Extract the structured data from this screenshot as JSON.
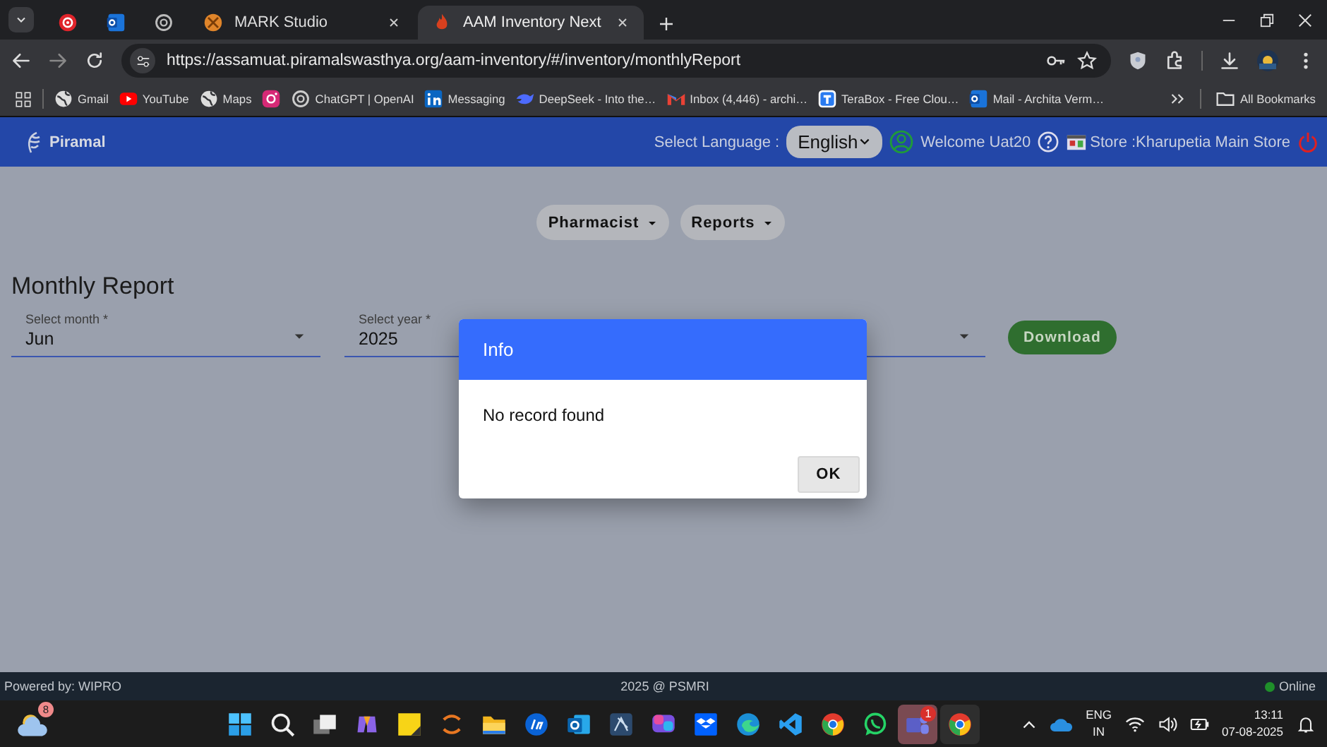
{
  "browser": {
    "tabs": [
      {
        "selected": false
      },
      {
        "selected": false
      },
      {
        "selected": false
      },
      {
        "title": "MARK Studio",
        "selected": false
      },
      {
        "title": "AAM Inventory Next",
        "selected": true
      }
    ],
    "url": "https://assamuat.piramalswasthya.org/aam-inventory/#/inventory/monthlyReport",
    "bookmarks": [
      {
        "kind": "link",
        "label": "Gmail"
      },
      {
        "kind": "link",
        "label": "YouTube"
      },
      {
        "kind": "link",
        "label": "Maps"
      },
      {
        "kind": "icon"
      },
      {
        "kind": "link",
        "label": "ChatGPT | OpenAI"
      },
      {
        "kind": "link",
        "label": "Messaging"
      },
      {
        "kind": "link",
        "label": "DeepSeek - Into the…"
      },
      {
        "kind": "link",
        "label": "Inbox (4,446) - archi…"
      },
      {
        "kind": "link",
        "label": "TeraBox - Free Clou…"
      },
      {
        "kind": "link",
        "label": "Mail - Archita Verm…"
      }
    ],
    "all_bookmarks": "All Bookmarks"
  },
  "header": {
    "brand": "Piramal",
    "language_label": "Select Language :",
    "language": "English",
    "welcome": "Welcome Uat20",
    "store": "Store :Kharupetia Main Store"
  },
  "nav": [
    "Pharmacist",
    "Reports"
  ],
  "page_title": "Monthly Report",
  "fields": [
    {
      "kind": "select",
      "label": "Select month *",
      "value": "Jun"
    },
    {
      "kind": "select",
      "label": "Select year *",
      "value": "2025"
    },
    {
      "kind": "select"
    }
  ],
  "download_button": "Download",
  "dialog": {
    "title": "Info",
    "message": "No record found",
    "button": "OK"
  },
  "footer": {
    "left": "Powered by: WIPRO",
    "center": "2025 @ PSMRI",
    "status": "Online"
  },
  "taskbar": {
    "weather_badge": "8",
    "chat_badge": "1",
    "language": "ENG",
    "region": "IN",
    "time": "13:11",
    "date": "07-08-2025"
  }
}
